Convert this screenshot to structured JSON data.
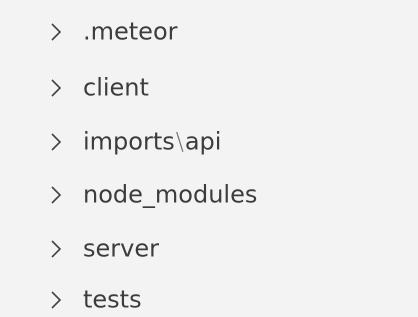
{
  "explorer": {
    "items": [
      {
        "label": ".meteor",
        "expanded": false,
        "icon": "chevron-right-icon"
      },
      {
        "label": "client",
        "expanded": false,
        "icon": "chevron-right-icon"
      },
      {
        "label_parts": [
          "imports",
          "\\",
          "api"
        ],
        "expanded": false,
        "icon": "chevron-right-icon"
      },
      {
        "label": "node_modules",
        "expanded": false,
        "icon": "chevron-right-icon"
      },
      {
        "label": "server",
        "expanded": false,
        "icon": "chevron-right-icon"
      },
      {
        "label": "tests",
        "expanded": false,
        "icon": "chevron-right-icon"
      }
    ]
  },
  "colors": {
    "background": "#f3f3f3",
    "text": "#3c3c3c",
    "chevron": "#424242"
  }
}
